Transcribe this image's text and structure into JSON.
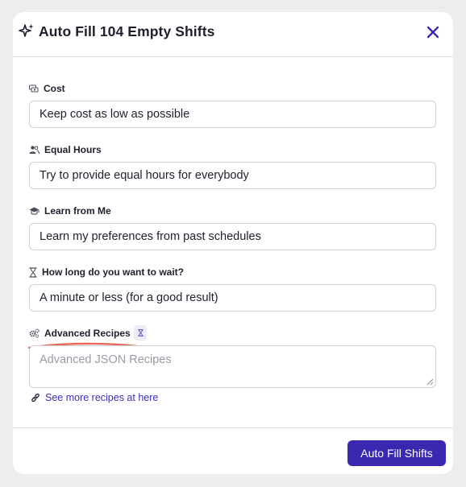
{
  "dialog": {
    "title": "Auto Fill 104 Empty Shifts",
    "close_icon": "close-icon",
    "title_icon": "sparkles-icon"
  },
  "fields": [
    {
      "label": "Cost",
      "icon": "money-icon",
      "value": "Keep cost as low as possible"
    },
    {
      "label": "Equal Hours",
      "icon": "users-icon",
      "value": "Try to provide equal hours for everybody"
    },
    {
      "label": "Learn from Me",
      "icon": "graduation-cap-icon",
      "value": "Learn my preferences from past schedules"
    },
    {
      "label": "How long do you want to wait?",
      "icon": "hourglass-icon",
      "value": "A minute or less (for a good result)"
    }
  ],
  "advanced": {
    "label": "Advanced Recipes",
    "icon": "gears-icon",
    "info_icon": "hourglass-icon",
    "placeholder": "Advanced JSON Recipes",
    "annotation_color": "#e8665a"
  },
  "link": {
    "text": "See more recipes at here",
    "icon": "link-icon"
  },
  "footer": {
    "primary_label": "Auto Fill Shifts"
  },
  "colors": {
    "accent": "#3a28b0",
    "link": "#3a2fb8",
    "text": "#1f1f2e"
  }
}
